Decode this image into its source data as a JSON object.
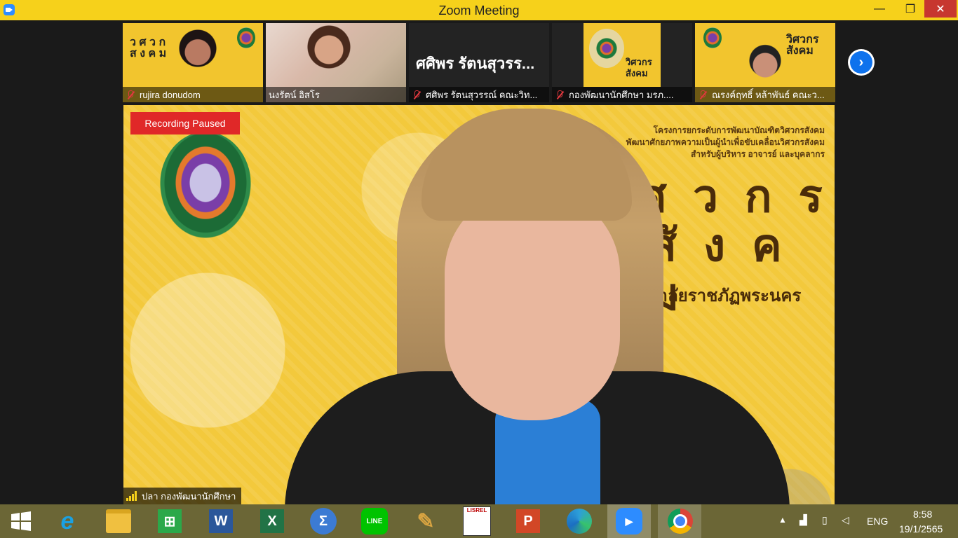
{
  "window": {
    "title": "Zoom Meeting",
    "minimize_glyph": "—",
    "maximize_glyph": "❐",
    "close_glyph": "✕"
  },
  "thumbnails": [
    {
      "name": "rujira donudom",
      "style": "yellow"
    },
    {
      "name": "นงรัตน์ อิสโร",
      "style": "photo"
    },
    {
      "name": "ศศิพร รัตนสุวรรณ์ คณะวิท...",
      "big_name": "ศศิพร รัตนสุวรร...",
      "style": "dark"
    },
    {
      "name": "กองพัฒนานักศึกษา มรภ....",
      "style": "dark"
    },
    {
      "name": "ณรงค์ฤทธิ์ หล้าพันธ์ คณะว...",
      "style": "yellow"
    }
  ],
  "thumb_logo_text": {
    "t1": "ว ศ ว ก\nส ง ค ม",
    "t4": "วิศวกร\nสังคม",
    "t5": "วิศวกร\nสังคม"
  },
  "next_page_glyph": "›",
  "main_video": {
    "recording_status": "Recording Paused",
    "speaker_name": "ปลา กองพัฒนานักศึกษา",
    "banner_lines": [
      "โครงการยกระดับการพัฒนาบัณฑิตวิศวกรสังคม",
      "พัฒนาศักยภาพความเป็นผู้นำเพื่อขับเคลื่อนวิศวกรสังคม",
      "สำหรับผู้บริหาร อาจารย์ และบุคลากร"
    ],
    "big_title_line1": "วิ ศ ว ก ร",
    "big_title_line2": "สั ง ค ม",
    "subtitle": "มหาวิทยาลัยราชภัฏพระนคร"
  },
  "taskbar": {
    "apps": [
      {
        "name": "internet-explorer",
        "glyph": "e",
        "color": "#1ba1e2"
      },
      {
        "name": "file-explorer",
        "glyph": "▭",
        "color": "#f0c040"
      },
      {
        "name": "store",
        "glyph": "⊞",
        "color": "#2ba84a"
      },
      {
        "name": "word",
        "glyph": "W",
        "color": "#2b579a"
      },
      {
        "name": "excel",
        "glyph": "X",
        "color": "#217346"
      },
      {
        "name": "math-input",
        "glyph": "Σ",
        "color": "#3c7bd3"
      },
      {
        "name": "line",
        "glyph": "LINE",
        "color": "#00c300"
      },
      {
        "name": "paint",
        "glyph": "✎",
        "color": "#d9a441"
      },
      {
        "name": "lisrel",
        "glyph": "LISREL",
        "color": "#ffffff"
      },
      {
        "name": "powerpoint",
        "glyph": "P",
        "color": "#d24726"
      },
      {
        "name": "edge",
        "glyph": "e",
        "color": "#2d9fd9"
      },
      {
        "name": "zoom",
        "glyph": "▶",
        "color": "#2d8cff"
      },
      {
        "name": "chrome",
        "glyph": "●",
        "color": "#db4437"
      }
    ],
    "language": "ENG",
    "time": "8:58",
    "date": "19/1/2565"
  }
}
